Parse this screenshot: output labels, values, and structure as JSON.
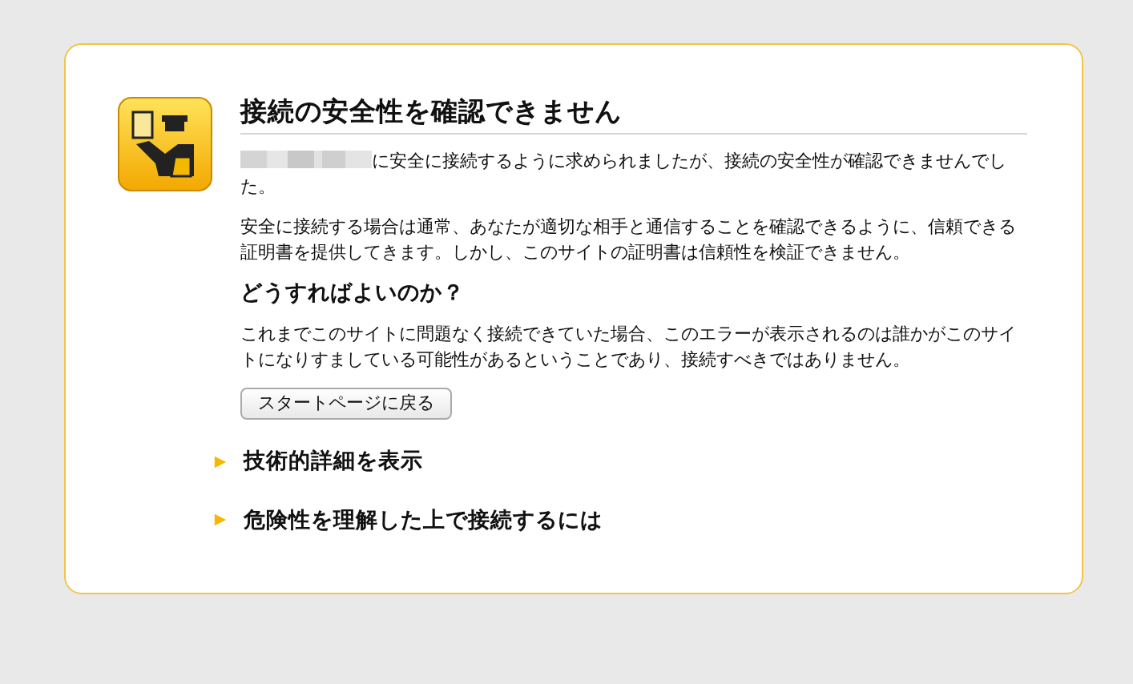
{
  "title": "接続の安全性を確認できません",
  "intro": "に安全に接続するように求められましたが、接続の安全性が確認できませんでした。",
  "explanation": "安全に接続する場合は通常、あなたが適切な相手と通信することを確認できるように、信頼できる証明書を提供してきます。しかし、このサイトの証明書は信頼性を検証できません。",
  "what_to_do": {
    "heading": "どうすればよいのか？",
    "text": "これまでこのサイトに問題なく接続できていた場合、このエラーが表示されるのは誰かがこのサイトになりすましている可能性があるということであり、接続すべきではありません。",
    "button": "スタートページに戻る"
  },
  "sections": [
    {
      "label": "技術的詳細を表示",
      "expanded": false
    },
    {
      "label": "危険性を理解した上で接続するには",
      "expanded": false
    }
  ]
}
